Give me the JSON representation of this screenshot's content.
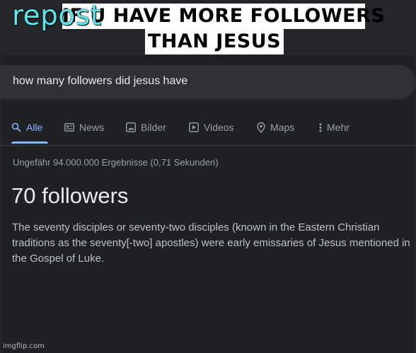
{
  "meme": {
    "caption_line1": "IF U HAVE MORE FOLLOWERS",
    "caption_line2": "THAN JESUS",
    "repost_label": "repost"
  },
  "search": {
    "query": "how many followers did jesus have"
  },
  "tabs": [
    {
      "label": "Alle",
      "icon": "search-icon",
      "active": true
    },
    {
      "label": "News",
      "icon": "newspaper-icon",
      "active": false
    },
    {
      "label": "Bilder",
      "icon": "image-icon",
      "active": false
    },
    {
      "label": "Videos",
      "icon": "play-icon",
      "active": false
    },
    {
      "label": "Maps",
      "icon": "map-pin-icon",
      "active": false
    },
    {
      "label": "Mehr",
      "icon": "more-vert-icon",
      "active": false
    }
  ],
  "results": {
    "stats": "Ungefähr 94.000.000 Ergebnisse (0,71 Sekunden)",
    "answer": "70 followers",
    "snippet": "The seventy disciples or seventy-two disciples (known in the Eastern Christian traditions as the seventy[-two] apostles) were early emissaries of Jesus mentioned in the Gospel of Luke."
  },
  "watermark": "imgflip.com",
  "colors": {
    "background": "#202124",
    "accent": "#8ab4f8",
    "text_primary": "#e8eaed",
    "text_secondary": "#9aa0a6",
    "repost": "#5fe3e8"
  }
}
